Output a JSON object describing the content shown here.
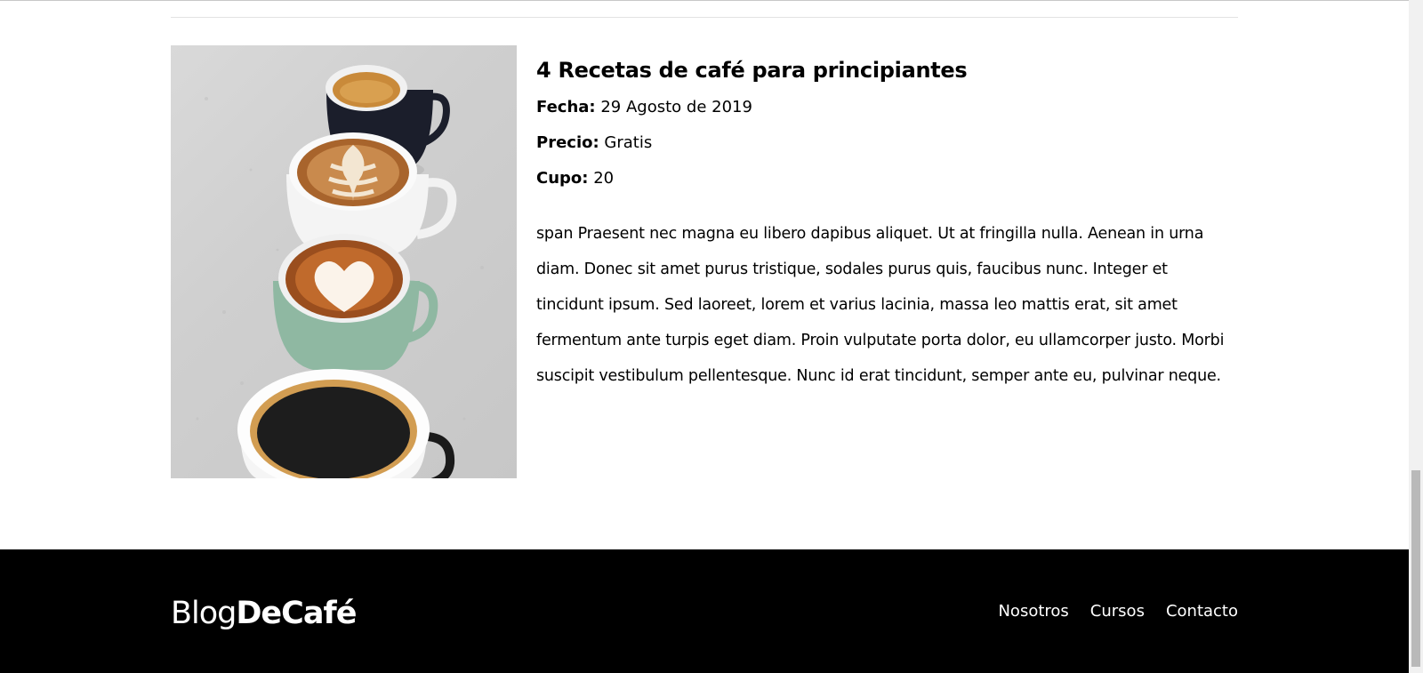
{
  "course": {
    "title": "4 Recetas de café para principiantes",
    "image_alt": "Cuatro tazas de café",
    "fecha_label": "Fecha:",
    "fecha_value": "29 Agosto de 2019",
    "precio_label": "Precio:",
    "precio_value": "Gratis",
    "cupo_label": "Cupo:",
    "cupo_value": "20",
    "description": "span Praesent nec magna eu libero dapibus aliquet. Ut at fringilla nulla. Aenean in urna diam. Donec sit amet purus tristique, sodales purus quis, faucibus nunc. Integer et tincidunt ipsum. Sed laoreet, lorem et varius lacinia, massa leo mattis erat, sit amet fermentum ante turpis eget diam. Proin vulputate porta dolor, eu ullamcorper justo. Morbi suscipit vestibulum pellentesque. Nunc id erat tincidunt, semper ante eu, pulvinar neque."
  },
  "footer": {
    "logo_light": "Blog",
    "logo_bold": "DeCafé",
    "nav": [
      {
        "label": "Nosotros"
      },
      {
        "label": "Cursos"
      },
      {
        "label": "Contacto"
      }
    ]
  },
  "colors": {
    "footer_bg": "#000000",
    "footer_text": "#ffffff",
    "page_bg": "#ffffff"
  }
}
